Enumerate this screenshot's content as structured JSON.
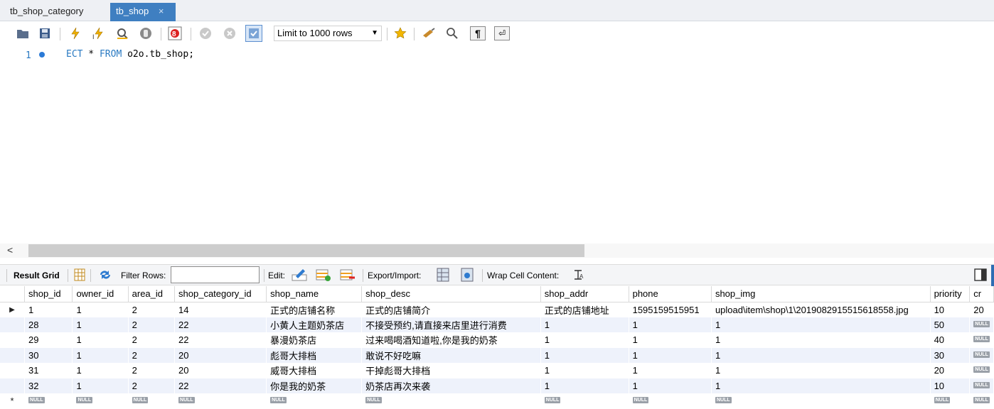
{
  "tabs": [
    {
      "label": "tb_shop_category"
    },
    {
      "label": "tb_shop",
      "close": "×"
    }
  ],
  "toolbar": {
    "limit_label": "Limit to 1000 rows"
  },
  "editor": {
    "line_number": "1",
    "code_keyword1": "ECT",
    "code_mid": " * ",
    "code_keyword2": "FROM",
    "code_rest": " o2o.tb_shop;"
  },
  "scroll": {
    "left_arrow": "<"
  },
  "resultbar": {
    "result_grid": "Result Grid",
    "filter_rows": "Filter Rows:",
    "edit": "Edit:",
    "export_import": "Export/Import:",
    "wrap_cell": "Wrap Cell Content:"
  },
  "grid": {
    "columns": [
      "shop_id",
      "owner_id",
      "area_id",
      "shop_category_id",
      "shop_name",
      "shop_desc",
      "shop_addr",
      "phone",
      "shop_img",
      "priority",
      "cr"
    ],
    "rows": [
      [
        "1",
        "1",
        "2",
        "14",
        "正式的店铺名称",
        "正式的店铺简介",
        "正式的店铺地址",
        "1595159515951",
        "upload\\item\\shop\\1\\2019082915515618558.jpg",
        "10",
        "20"
      ],
      [
        "28",
        "1",
        "2",
        "22",
        "小黄人主题奶茶店",
        "不接受预约,请直接来店里进行消费",
        "1",
        "1",
        "1",
        "50",
        "NULL"
      ],
      [
        "29",
        "1",
        "2",
        "22",
        "暴漫奶茶店",
        "过来喝喝酒知道啦,你是我的奶茶",
        "1",
        "1",
        "1",
        "40",
        "NULL"
      ],
      [
        "30",
        "1",
        "2",
        "20",
        "彪哥大排档",
        "敢说不好吃嘛",
        "1",
        "1",
        "1",
        "30",
        "NULL"
      ],
      [
        "31",
        "1",
        "2",
        "20",
        "威哥大排档",
        "干掉彪哥大排档",
        "1",
        "1",
        "1",
        "20",
        "NULL"
      ],
      [
        "32",
        "1",
        "2",
        "22",
        "你是我的奶茶",
        "奶茶店再次来袭",
        "1",
        "1",
        "1",
        "10",
        "NULL"
      ]
    ],
    "new_row": [
      "NULL",
      "NULL",
      "NULL",
      "NULL",
      "NULL",
      "NULL",
      "NULL",
      "NULL",
      "NULL",
      "NULL",
      "NULL"
    ],
    "current_row_marker": "▶",
    "new_row_marker": "*"
  }
}
